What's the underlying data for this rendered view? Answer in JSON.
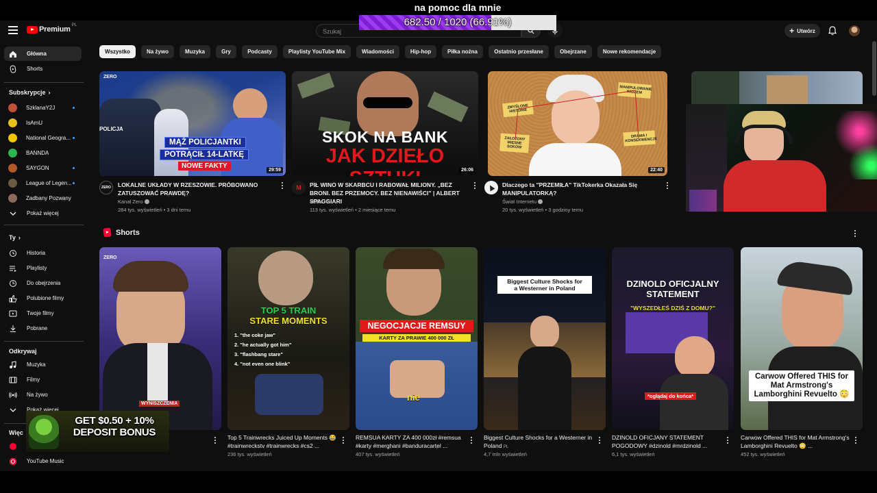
{
  "overlay": {
    "title": "na pomoc dla mnie",
    "progress_text": "682.50 / 1020 (66.91%)",
    "progress_fraction": 0.6691
  },
  "header": {
    "logo_text": "Premium",
    "logo_region": "PL",
    "search_placeholder": "Szukaj",
    "create_label": "Utwórz"
  },
  "sidebar": {
    "main": [
      {
        "label": "Główna",
        "icon": "home-icon"
      },
      {
        "label": "Shorts",
        "icon": "shorts-icon"
      }
    ],
    "subs_heading": "Subskrypcje",
    "subscriptions": [
      {
        "label": "SzklanaY2J",
        "color": "#c0503a",
        "dot": true
      },
      {
        "label": "IsAmU",
        "color": "#e8c01a",
        "dot": false
      },
      {
        "label": "National Geogra...",
        "color": "#f5c400",
        "dot": true
      },
      {
        "label": "BANNDA",
        "color": "#2bb84a",
        "dot": false
      },
      {
        "label": "SAYGON",
        "color": "#b05a2a",
        "dot": true
      },
      {
        "label": "League of Legen...",
        "color": "#6a5a40",
        "dot": true
      },
      {
        "label": "Zadbany Pozwany",
        "color": "#8a6a5a",
        "dot": false
      }
    ],
    "subs_more": "Pokaż więcej",
    "you_heading": "Ty",
    "you_items": [
      {
        "label": "Historia",
        "icon": "history-icon"
      },
      {
        "label": "Playlisty",
        "icon": "playlist-icon"
      },
      {
        "label": "Do obejrzenia",
        "icon": "watch-later-icon"
      },
      {
        "label": "Polubione filmy",
        "icon": "like-icon"
      },
      {
        "label": "Twoje filmy",
        "icon": "your-videos-icon"
      },
      {
        "label": "Pobrane",
        "icon": "download-icon"
      }
    ],
    "explore_heading": "Odkrywaj",
    "explore_items": [
      {
        "label": "Muzyka",
        "icon": "music-icon"
      },
      {
        "label": "Filmy",
        "icon": "movies-icon"
      },
      {
        "label": "Na żywo",
        "icon": "live-icon"
      },
      {
        "label": "Pokaż więcej",
        "icon": "chevron-down-icon"
      }
    ],
    "more_heading": "Więc",
    "more_items": [
      {
        "label": "YouTube Music",
        "icon": "youtube-music-icon"
      }
    ]
  },
  "chips": [
    "Wszystko",
    "Na żywo",
    "Muzyka",
    "Gry",
    "Podcasty",
    "Playlisty YouTube Mix",
    "Wiadomości",
    "Hip-hop",
    "Piłka nożna",
    "Ostatnio przesłane",
    "Obejrzane",
    "Nowe rekomendacje"
  ],
  "videos": [
    {
      "title": "LOKALNE UKŁADY W RZESZOWIE. PRÓBOWANO ZATUSZOWAĆ PRAWDĘ?",
      "channel": "Kanał Zero",
      "meta": "284 tys. wyświetleń • 3 dni temu",
      "duration": "29:59",
      "thumb_lines": [
        "MĄŻ POLICJANTKI",
        "POTRĄCIŁ 14-LATKĘ",
        "NOWE FAKTY"
      ],
      "thumb_corner": "ZERO",
      "thumb_side": "POLICJA",
      "avatar_text": "ZERO"
    },
    {
      "title": "PIŁ WINO W SKARBCU I RABOWAŁ MILIONY. „BEZ BRONI. BEZ PRZEMOCY. BEZ NIENAWIŚCI” | ALBERT SPAGGIARI",
      "channel": "Mafia PL",
      "meta": "113 tys. wyświetleń • 2 miesiące temu",
      "duration": "26:06",
      "thumb_lines": [
        "SKOK NA BANK",
        "JAK DZIEŁO SZTUKI"
      ],
      "avatar_text": "M"
    },
    {
      "title": "Dlaczego ta \"PRZEMIŁA\" TikTokerka Okazała Się MANIPULATORKĄ?",
      "channel": "Świat Internetu",
      "meta": "20 tys. wyświetleń • 3 godziny temu",
      "duration": "22:40",
      "thumb_notes": [
        "ZMYŚLONE HISTORIE",
        "ZAŁOŻONY MIĘSNE SOKÓW",
        "MANIPULOWANIE WIDZEM",
        "DRAMA I KONSEKWENCJE"
      ],
      "avatar_text": ""
    }
  ],
  "shorts_heading": "Shorts",
  "shorts": [
    {
      "title": "",
      "views": "",
      "thumb_lines": [
        "WYNISZCZENIA"
      ],
      "thumb_corner": "ZERO"
    },
    {
      "title": "Top 5 Trainwrecks Juiced Up Moments 😂 #trainwreckstv #trainwrecks #cs2 ...",
      "views": "236 tys. wyświetleń",
      "thumb_lines": [
        "TOP 5 TRAIN",
        "STARE MOMENTS"
      ],
      "thumb_list": [
        "1. \"the coke jaw\"",
        "2. \"he actually got him\"",
        "3. \"flashbang stare\"",
        "4. \"not even one blink\""
      ]
    },
    {
      "title": "REMSUA KARTY ZA 400 000zł #remsua #karty #merghani #banduracartel ...",
      "views": "407 tys. wyświetleń",
      "thumb_lines": [
        "NEGOCJACJE REMSUY",
        "KARTY ZA PRAWIE 400 000 ZŁ",
        "nie"
      ]
    },
    {
      "title": "Biggest Culture Shocks for a Westerner in Poland",
      "title_suffix": "PL",
      "views": "4,7 mln wyświetleń",
      "thumb_lines": [
        "Biggest Culture Shocks for",
        "a Westerner in Poland"
      ]
    },
    {
      "title": "DZINOLD OFICJANY STATEMENT POGODOWY #dzinold #mrdzinold ...",
      "views": "6,1 tys. wyświetleń",
      "thumb_lines": [
        "DZINOLD OFICJALNY",
        "STATEMENT",
        "\"WYSZEDŁEŚ DZIŚ Z DOMU?\"",
        "*oglądaj do końca*"
      ]
    },
    {
      "title": "Carwow Offered THIS for Mat Armstrong's Lamborghini Revuelto 😳 ...",
      "views": "452 tys. wyświetleń",
      "thumb_lines": [
        "Carwow Offered THIS for",
        "Mat Armstrong's",
        "Lamborghini Revuelto 😳"
      ]
    }
  ],
  "ad": {
    "lines": [
      "GET $0.50 + 10%",
      "DEPOSIT BONUS"
    ]
  },
  "colors": {
    "background": "#0f0f0f",
    "brand_red": "#ff0000",
    "progress_purple": "#8a2be2",
    "chip_bg": "#272727",
    "accent_blue": "#3ea6ff"
  }
}
